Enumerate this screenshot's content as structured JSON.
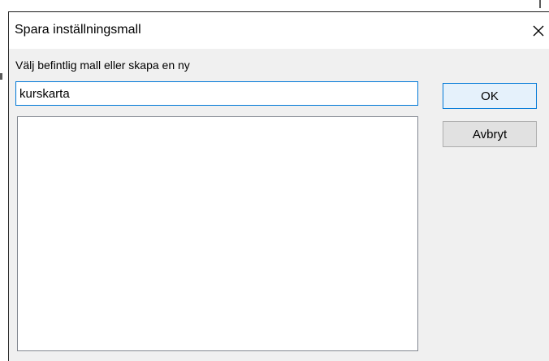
{
  "dialog": {
    "title": "Spara inställningsmall",
    "close_icon": "close-icon"
  },
  "form": {
    "prompt_label": "Välj befintlig mall eller skapa en ny",
    "name_value": "kurskarta",
    "template_list_items": []
  },
  "buttons": {
    "ok_label": "OK",
    "cancel_label": "Avbryt"
  },
  "colors": {
    "focus_border": "#0078d7",
    "ok_background": "#e5f1fb",
    "dialog_background": "#f0f0f0"
  }
}
